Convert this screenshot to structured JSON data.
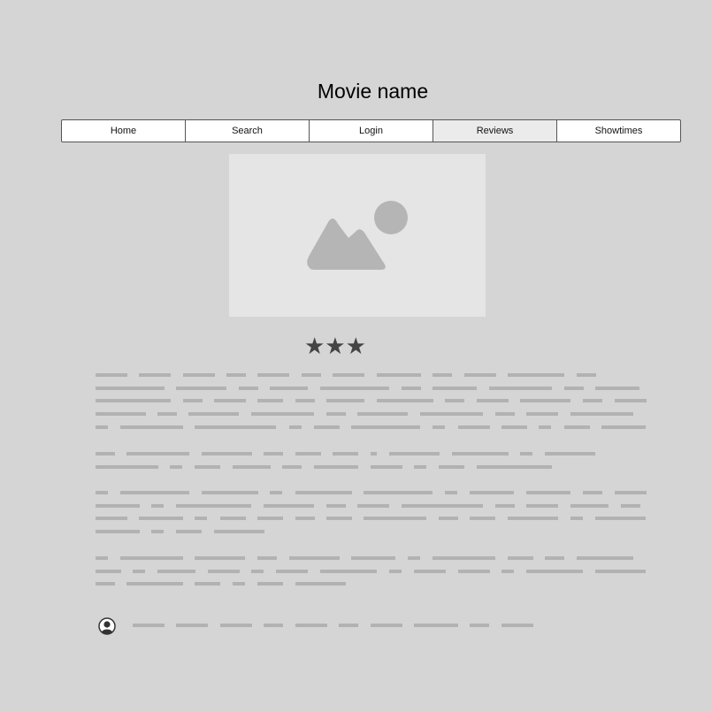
{
  "page": {
    "title": "Movie name"
  },
  "nav": {
    "items": [
      {
        "id": "home",
        "label": "Home"
      },
      {
        "id": "search",
        "label": "Search"
      },
      {
        "id": "login",
        "label": "Login"
      },
      {
        "id": "reviews",
        "label": "Reviews"
      },
      {
        "id": "showtimes",
        "label": "Showtimes"
      }
    ],
    "active": "reviews"
  },
  "hero": {
    "icon": "image-placeholder-icon"
  },
  "rating": {
    "stars": 3,
    "display": "★★★"
  },
  "colors": {
    "background": "#d5d5d5",
    "placeholder_line": "#b2b2b2",
    "hero_bg": "#e5e5e5",
    "hero_icon": "#b5b5b5",
    "star": "#444444",
    "active_tab": "#ebebeb"
  },
  "review": {
    "author_icon": "user-avatar-icon"
  }
}
